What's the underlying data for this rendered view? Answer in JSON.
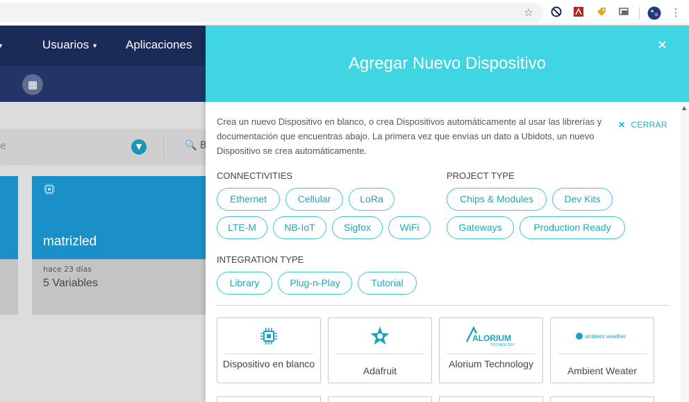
{
  "browser": {
    "icons": [
      "star-icon",
      "block-icon",
      "pdf-icon",
      "tag-icon",
      "cast-icon",
      "avatar",
      "menu-icon"
    ]
  },
  "background_app": {
    "nav": {
      "users": "Usuarios",
      "apps": "Aplicaciones"
    },
    "filter": {
      "placeholder_fragment": "e",
      "search_fragment": "B"
    },
    "card": {
      "title": "matrizled",
      "time": "hace 23 días",
      "variables": "5 Variables"
    }
  },
  "panel": {
    "title": "Agregar Nuevo Dispositivo",
    "intro": "Crea un nuevo Dispositivo en blanco, o crea Dispositivos automáticamente al usar las librerías y documentación que encuentras abajo. La primera vez que envías un dato a Ubidots, un nuevo Dispositivo se crea automáticamente.",
    "close_label": "CERRAR",
    "connectivities": {
      "title": "CONNECTIVITIES",
      "tags": [
        "Ethernet",
        "Cellular",
        "LoRa",
        "LTE-M",
        "NB-IoT",
        "Sigfox",
        "WiFi"
      ]
    },
    "project_type": {
      "title": "PROJECT TYPE",
      "tags": [
        "Chips & Modules",
        "Dev Kits",
        "Gateways",
        "Production Ready"
      ]
    },
    "integration_type": {
      "title": "INTEGRATION TYPE",
      "tags": [
        "Library",
        "Plug-n-Play",
        "Tutorial"
      ]
    },
    "devices": [
      {
        "label": "Dispositivo en blanco",
        "icon": "chip-icon"
      },
      {
        "label": "Adafruit",
        "icon": "adafruit-star-icon"
      },
      {
        "label": "Alorium Technology",
        "logo_text": "ALORIUM",
        "logo_sub": "TECHNOLOGY"
      },
      {
        "label": "Ambient Weater",
        "logo_text": "ambient weather"
      }
    ],
    "colors": {
      "accent": "#3fd5e3",
      "tag_text": "#1da9bb"
    }
  }
}
